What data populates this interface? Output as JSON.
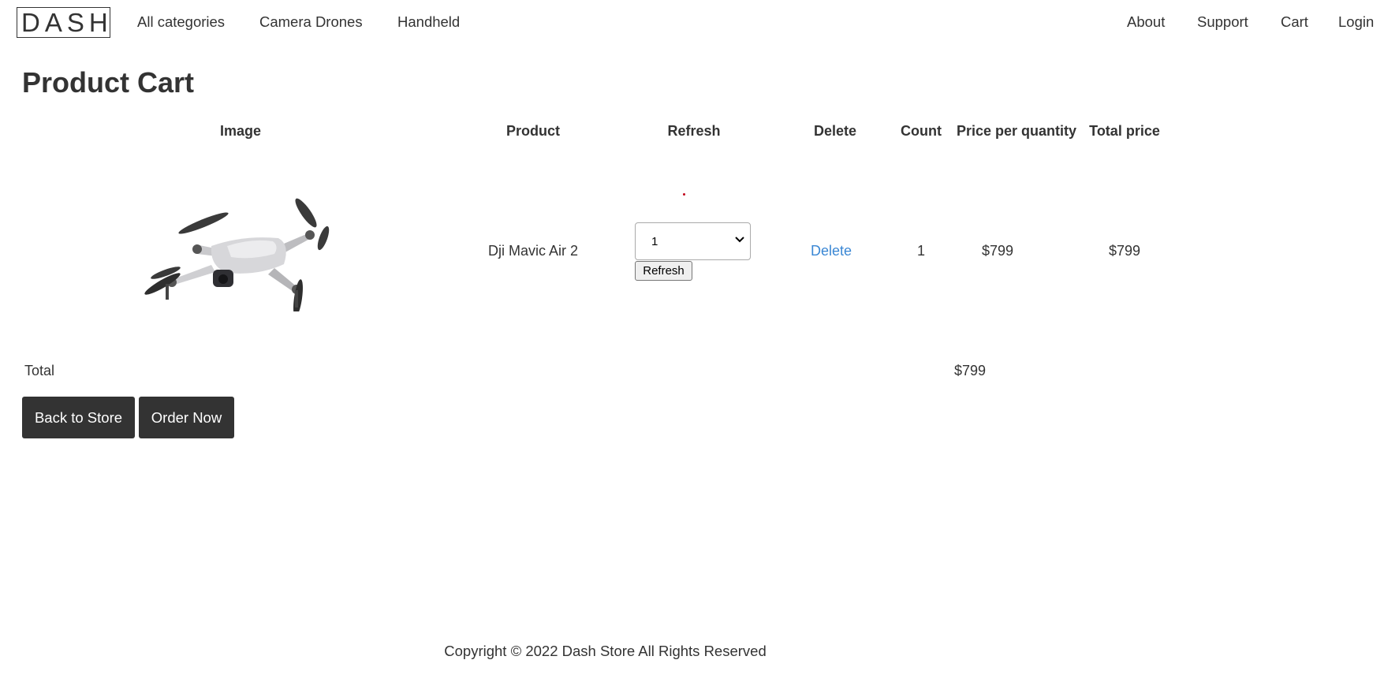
{
  "nav": {
    "logo": "DASH",
    "left_links": [
      "All categories",
      "Camera Drones",
      "Handheld"
    ],
    "right_links": [
      "About",
      "Support",
      "Cart",
      "Login"
    ]
  },
  "page_title": "Product Cart",
  "table": {
    "headers": [
      "Image",
      "Product",
      "Refresh",
      "Delete",
      "Count",
      "Price per quantity",
      "Total price"
    ],
    "rows": [
      {
        "image_alt": "drone-product-image",
        "product": "Dji Mavic Air 2",
        "quantity_selected": "1",
        "refresh_label": "Refresh",
        "delete_label": "Delete",
        "count": "1",
        "price_per_quantity": "$799",
        "total_price": "$799"
      }
    ]
  },
  "totals": {
    "label": "Total",
    "value": "$799"
  },
  "actions": {
    "back_label": "Back to Store",
    "order_label": "Order Now"
  },
  "footer": {
    "text": "Copyright © 2022 Dash Store All Rights Reserved"
  },
  "colors": {
    "text": "#333333",
    "link_blue": "#3a87d4",
    "button_dark": "#333333"
  }
}
